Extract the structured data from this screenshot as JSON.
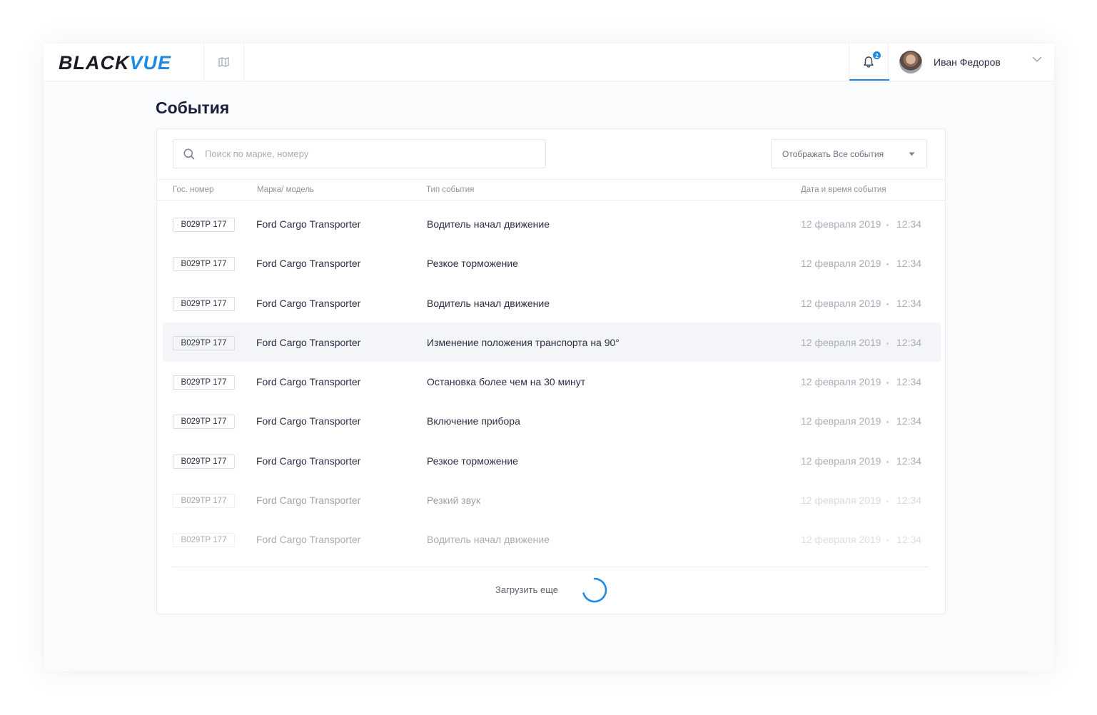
{
  "brand": {
    "part1": "BLACK",
    "part2": "VUE",
    "accent": "#1e8ae6"
  },
  "header": {
    "notifications_count": "2",
    "user_name": "Иван Федоров"
  },
  "page": {
    "title": "События"
  },
  "search": {
    "placeholder": "Поиск по марке, номеру",
    "value": ""
  },
  "filter": {
    "label": "Отображать Все события"
  },
  "table": {
    "columns": [
      "Гос. номер",
      "Марка/ модель",
      "Тип события",
      "Дата и время события"
    ],
    "rows": [
      {
        "plate": "В029ТР 177",
        "model": "Ford Cargo Transporter",
        "event": "Водитель начал движение",
        "date": "12 февраля 2019",
        "time": "12:34"
      },
      {
        "plate": "В029ТР 177",
        "model": "Ford Cargo Transporter",
        "event": "Резкое торможение",
        "date": "12 февраля 2019",
        "time": "12:34"
      },
      {
        "plate": "В029ТР 177",
        "model": "Ford Cargo Transporter",
        "event": "Водитель начал движение",
        "date": "12 февраля 2019",
        "time": "12:34"
      },
      {
        "plate": "В029ТР 177",
        "model": "Ford Cargo Transporter",
        "event": "Изменение положения транспорта на 90°",
        "date": "12 февраля 2019",
        "time": "12:34"
      },
      {
        "plate": "В029ТР 177",
        "model": "Ford Cargo Transporter",
        "event": "Остановка более чем на 30 минут",
        "date": "12 февраля 2019",
        "time": "12:34"
      },
      {
        "plate": "В029ТР 177",
        "model": "Ford Cargo Transporter",
        "event": "Включение прибора",
        "date": "12 февраля 2019",
        "time": "12:34"
      },
      {
        "plate": "В029ТР 177",
        "model": "Ford Cargo Transporter",
        "event": "Резкое торможение",
        "date": "12 февраля 2019",
        "time": "12:34"
      },
      {
        "plate": "В029ТР 177",
        "model": "Ford Cargo Transporter",
        "event": "Резкий звук",
        "date": "12 февраля 2019",
        "time": "12:34"
      },
      {
        "plate": "В029ТР 177",
        "model": "Ford Cargo Transporter",
        "event": "Водитель начал движение",
        "date": "12 февраля 2019",
        "time": "12:34"
      }
    ]
  },
  "footer": {
    "load_more": "Загрузить еще"
  },
  "icons": {
    "map": "map-icon",
    "bell": "bell-icon",
    "chevron": "chevron-down-icon",
    "search": "search-icon",
    "caret": "caret-down-icon",
    "spinner": "loading-spinner-icon"
  }
}
